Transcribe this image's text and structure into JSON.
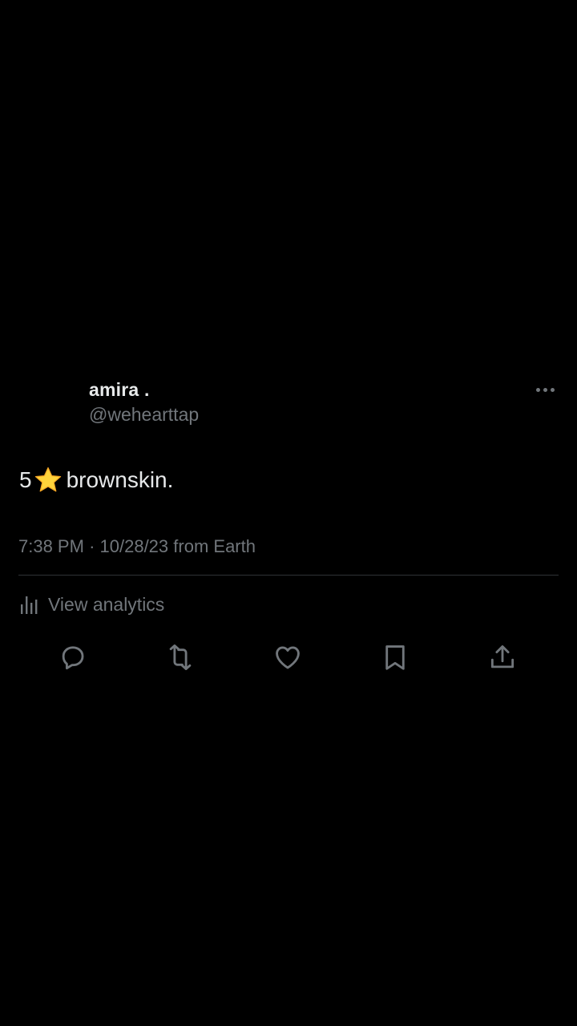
{
  "colors": {
    "background": "#000000",
    "primary_text": "#e7e9ea",
    "secondary_text": "#71767b",
    "divider": "#2f3336",
    "star": "#ffd43b"
  },
  "author": {
    "display_name": "amira .",
    "handle": "@wehearttap"
  },
  "tweet": {
    "text_prefix": "5",
    "emoji": "star",
    "text_suffix": "brownskin."
  },
  "meta": {
    "time": "7:38 PM",
    "separator": "·",
    "date": "10/28/23",
    "source": "from Earth"
  },
  "analytics": {
    "label": "View analytics",
    "icon": "bar-chart-icon"
  },
  "actions": [
    {
      "name": "reply",
      "icon": "comment-icon"
    },
    {
      "name": "retweet",
      "icon": "retweet-icon"
    },
    {
      "name": "like",
      "icon": "heart-icon"
    },
    {
      "name": "bookmark",
      "icon": "bookmark-icon"
    },
    {
      "name": "share",
      "icon": "share-icon"
    }
  ]
}
